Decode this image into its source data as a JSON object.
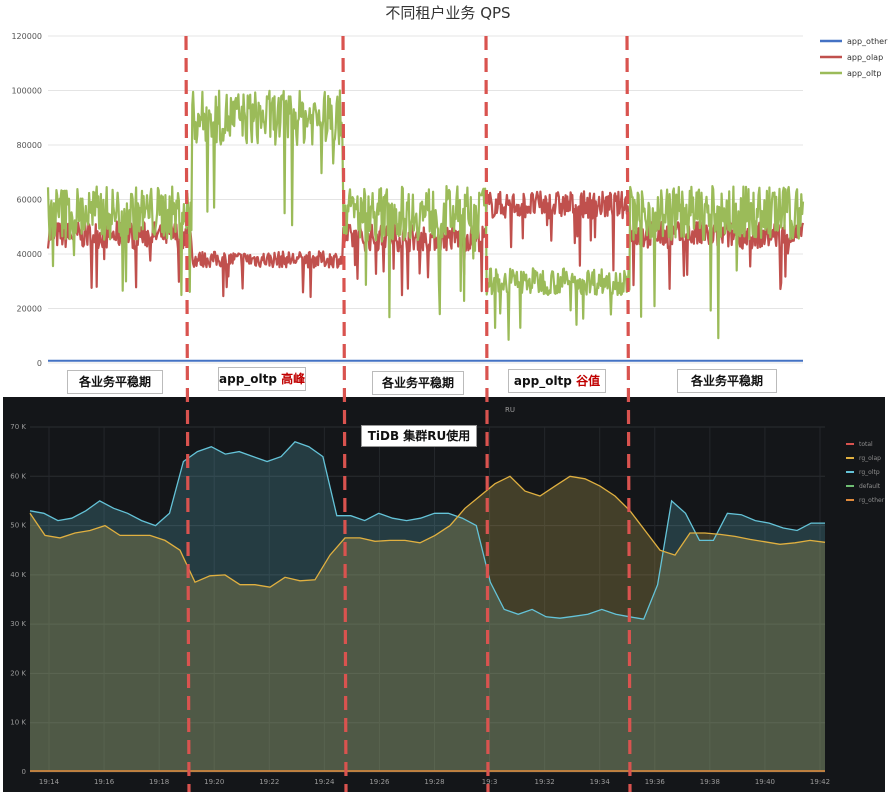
{
  "chart_data": [
    {
      "type": "line",
      "title": "不同租户业务 QPS",
      "ylim": [
        0,
        120000
      ],
      "yticks": [
        0,
        20000,
        40000,
        60000,
        80000,
        100000,
        120000
      ],
      "grid": true,
      "legend_position": "right",
      "series": [
        {
          "name": "app_other",
          "color": "#4472c4",
          "segments": [
            {
              "t0": 0,
              "t1": 1,
              "mean": 800,
              "amp": 0
            }
          ]
        },
        {
          "name": "app_olap",
          "color": "#c0504d",
          "segments": [
            {
              "t0": 0.0,
              "t1": 0.19,
              "mean": 47000,
              "amp": 5000
            },
            {
              "t0": 0.19,
              "t1": 0.39,
              "mean": 38000,
              "amp": 3000
            },
            {
              "t0": 0.39,
              "t1": 0.58,
              "mean": 46000,
              "amp": 5000
            },
            {
              "t0": 0.58,
              "t1": 0.77,
              "mean": 58000,
              "amp": 5000
            },
            {
              "t0": 0.77,
              "t1": 1.0,
              "mean": 47000,
              "amp": 5000
            }
          ]
        },
        {
          "name": "app_oltp",
          "color": "#9bbb59",
          "segments": [
            {
              "t0": 0.0,
              "t1": 0.19,
              "mean": 55000,
              "amp": 10000
            },
            {
              "t0": 0.19,
              "t1": 0.39,
              "mean": 90000,
              "amp": 10000
            },
            {
              "t0": 0.39,
              "t1": 0.58,
              "mean": 55000,
              "amp": 10000
            },
            {
              "t0": 0.58,
              "t1": 0.77,
              "mean": 30000,
              "amp": 5000
            },
            {
              "t0": 0.77,
              "t1": 1.0,
              "mean": 55000,
              "amp": 10000
            }
          ]
        }
      ]
    },
    {
      "type": "area",
      "title": "RU",
      "ylim": [
        0,
        70
      ],
      "yticks": [
        "0",
        "10 K",
        "20 K",
        "30 K",
        "40 K",
        "50 K",
        "60 K",
        "70 K"
      ],
      "x": [
        "19:14",
        "19:15",
        "19:16",
        "19:17",
        "19:18",
        "19:19",
        "19:20",
        "19:21",
        "19:22",
        "19:23",
        "19:24",
        "19:25",
        "19:26",
        "19:27",
        "19:28",
        "19:29",
        "19:30",
        "19:31",
        "19:32",
        "19:33",
        "19:34",
        "19:35",
        "19:36",
        "19:37",
        "19:38",
        "19:39",
        "19:40",
        "19:41",
        "19:42"
      ],
      "xticks": [
        "19:14",
        "19:16",
        "19:18",
        "19:20",
        "19:22",
        "19:24",
        "19:26",
        "19:28",
        "19:3",
        "19:32",
        "19:34",
        "19:36",
        "19:38",
        "19:40",
        "19:42"
      ],
      "legend": [
        "total",
        "rg_olap",
        "rg_oltp",
        "default",
        "rg_other"
      ],
      "series": [
        {
          "name": "rg_olap",
          "color": "#e0b040",
          "values": [
            52.5,
            48,
            47.5,
            48.5,
            49,
            50,
            48,
            48,
            48,
            47,
            45,
            38.5,
            39.8,
            40,
            38,
            38,
            37.5,
            39.5,
            38.8,
            39,
            44,
            47.5,
            47.5,
            46.8,
            47,
            47,
            46.5,
            48,
            50,
            53.5,
            56,
            58.5,
            60,
            57,
            56,
            58,
            60,
            59.5,
            58,
            56,
            53,
            49,
            45,
            44,
            48.5,
            48.5,
            48.2,
            47.8,
            47.2,
            46.7,
            46.2,
            46.5,
            47,
            46.6
          ]
        },
        {
          "name": "rg_oltp",
          "color": "#64c3d8",
          "values": [
            53,
            52.5,
            51,
            51.5,
            53,
            55,
            53.5,
            52.5,
            51,
            50,
            52.5,
            63,
            65,
            66,
            64.5,
            65,
            64,
            63,
            64,
            67,
            66,
            64,
            52,
            52,
            51,
            52.5,
            51.5,
            51,
            51.5,
            52.5,
            52.5,
            51.5,
            50,
            38.5,
            33,
            32,
            33,
            31.5,
            31.2,
            31.6,
            32,
            33,
            32,
            31.5,
            31,
            38,
            55,
            52.5,
            47,
            47,
            52.5,
            52.2,
            51,
            50.5,
            49.5,
            49,
            50.5,
            50.5
          ]
        },
        {
          "name": "rg_other",
          "color": "#e08a3c",
          "values": [
            0
          ]
        }
      ]
    }
  ],
  "phase_labels": {
    "p1": "各业务平稳期",
    "p2_prefix": "app_oltp ",
    "p2_highlight": "高峰",
    "p3": "各业务平稳期",
    "p4_prefix": "app_oltp ",
    "p4_highlight": "谷值",
    "p5": "各业务平稳期"
  },
  "ru_panel_heading": "TiDB 集群RU使用",
  "colors": {
    "divider": "#d9534f"
  }
}
